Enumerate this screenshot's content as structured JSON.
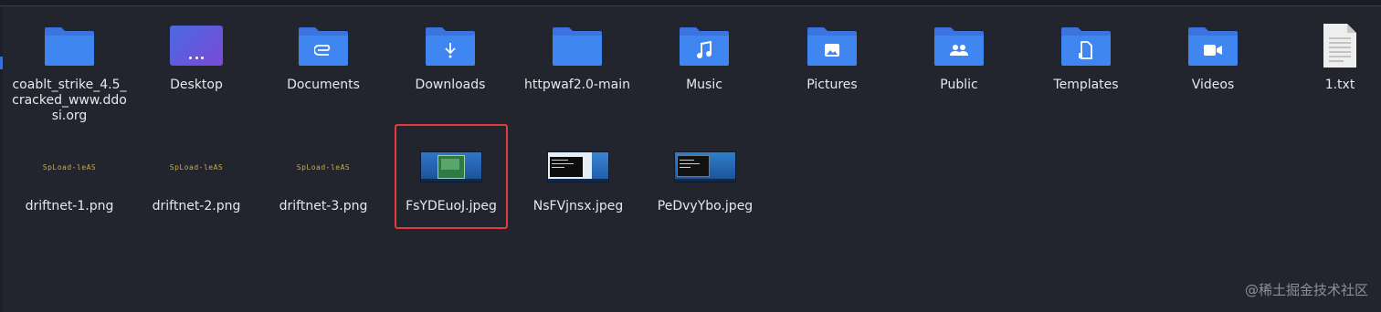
{
  "files_row1": [
    {
      "name": "coablt_strike_4.5_cracked_www.ddosi.org",
      "icon": "folder-icon"
    },
    {
      "name": "Desktop",
      "icon": "desktop-icon"
    },
    {
      "name": "Documents",
      "icon": "folder-documents-icon"
    },
    {
      "name": "Downloads",
      "icon": "folder-downloads-icon"
    },
    {
      "name": "httpwaf2.0-main",
      "icon": "folder-icon"
    },
    {
      "name": "Music",
      "icon": "folder-music-icon"
    },
    {
      "name": "Pictures",
      "icon": "folder-pictures-icon"
    },
    {
      "name": "Public",
      "icon": "folder-public-icon"
    },
    {
      "name": "Templates",
      "icon": "folder-templates-icon"
    },
    {
      "name": "Videos",
      "icon": "folder-videos-icon"
    },
    {
      "name": "1.txt",
      "icon": "text-file-icon"
    }
  ],
  "files_row2": [
    {
      "name": "driftnet-1.png",
      "icon": "image-thumbnail"
    },
    {
      "name": "driftnet-2.png",
      "icon": "image-thumbnail"
    },
    {
      "name": "driftnet-3.png",
      "icon": "image-thumbnail"
    },
    {
      "name": "FsYDEuoJ.jpeg",
      "icon": "image-thumbnail",
      "selected": true
    },
    {
      "name": "NsFVjnsx.jpeg",
      "icon": "image-thumbnail"
    },
    {
      "name": "PeDvyYbo.jpeg",
      "icon": "image-thumbnail"
    }
  ],
  "thumbnail_text": "SpLoad-leAS",
  "watermark": "@稀土掘金技术社区",
  "colors": {
    "background": "#23252e",
    "folder": "#3d7de8",
    "folder_tab": "#5b93f0",
    "selection_outline": "#e23b3b"
  }
}
